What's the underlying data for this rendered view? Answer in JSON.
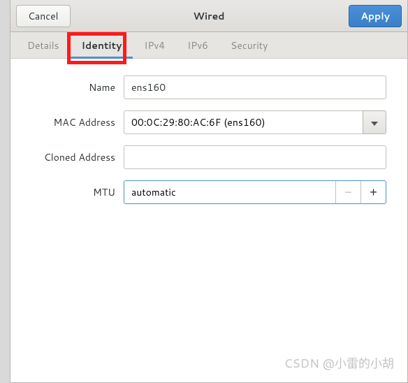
{
  "header": {
    "title": "Wired",
    "cancel_label": "Cancel",
    "apply_label": "Apply"
  },
  "tabs": {
    "details": "Details",
    "identity": "Identity",
    "ipv4": "IPv4",
    "ipv6": "IPv6",
    "security": "Security"
  },
  "form": {
    "name_label": "Name",
    "name_value": "ens160",
    "mac_label": "MAC Address",
    "mac_value": "00:0C:29:80:AC:6F (ens160)",
    "cloned_label": "Cloned Address",
    "cloned_value": "",
    "mtu_label": "MTU",
    "mtu_value": "automatic",
    "mtu_minus": "−",
    "mtu_plus": "+"
  },
  "watermark": "CSDN @小雷的小胡"
}
